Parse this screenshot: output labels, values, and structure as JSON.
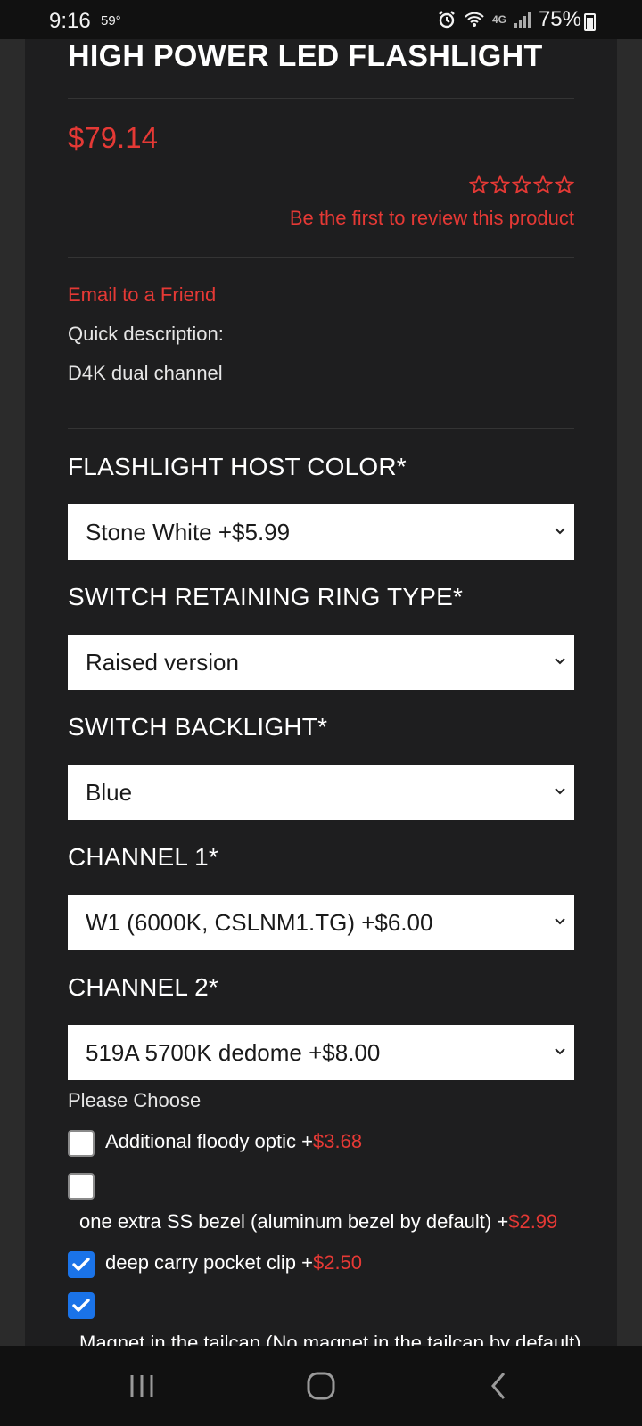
{
  "status": {
    "time": "9:16",
    "temp": "59°",
    "network": "4G",
    "battery": "75%"
  },
  "product": {
    "title": "HIGH POWER LED FLASHLIGHT",
    "price": "$79.14",
    "rating": {
      "stars": 0,
      "max": 5
    },
    "review_link": "Be the first to review this product",
    "email_link": "Email to a Friend",
    "quick_label": "Quick description:",
    "quick_text": "D4K dual channel"
  },
  "options": [
    {
      "label": "FLASHLIGHT HOST COLOR*",
      "selected": "Stone White +$5.99"
    },
    {
      "label": "SWITCH RETAINING RING TYPE*",
      "selected": "Raised version"
    },
    {
      "label": "SWITCH BACKLIGHT*",
      "selected": "Blue"
    },
    {
      "label": "CHANNEL 1*",
      "selected": "W1 (6000K, CSLNM1.TG) +$6.00"
    },
    {
      "label": "CHANNEL 2*",
      "selected": "519A 5700K dedome +$8.00"
    }
  ],
  "addons_label": "Please Choose",
  "addons": [
    {
      "label": "Additional floody optic +",
      "price": "$3.68",
      "checked": false
    },
    {
      "label": "one extra SS bezel (aluminum bezel by default) +",
      "price": "$2.99",
      "checked": false
    },
    {
      "label": "deep carry pocket clip +",
      "price": "$2.50",
      "checked": true
    },
    {
      "label": "Magnet in the tailcap (No magnet in the tailcap by default)",
      "price": "",
      "checked": true
    }
  ]
}
